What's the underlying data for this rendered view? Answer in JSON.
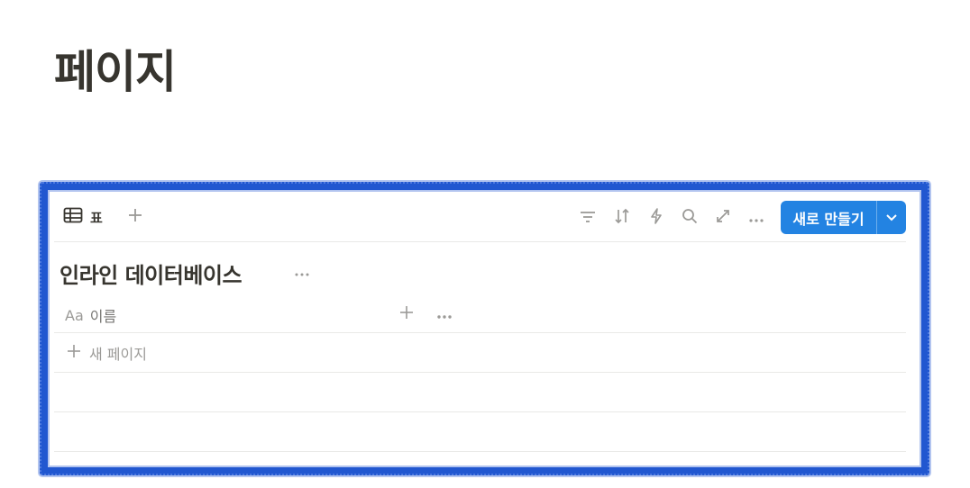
{
  "page": {
    "title": "페이지"
  },
  "database": {
    "view_tab_label": "표",
    "title": "인라인 데이터베이스",
    "new_button_label": "새로 만들기",
    "columns": [
      {
        "type_icon": "Aa",
        "label": "이름"
      }
    ],
    "new_page_label": "새 페이지"
  },
  "icons": {
    "view": "table-icon",
    "add_view": "plus-icon",
    "filter": "filter-icon",
    "sort": "sort-icon",
    "automation": "lightning-icon",
    "search": "search-icon",
    "expand": "expand-icon",
    "more": "more-icon"
  },
  "colors": {
    "accent": "#2383e2",
    "highlight": "#2157d0",
    "text": "#37352f",
    "muted": "#9b9a97"
  }
}
